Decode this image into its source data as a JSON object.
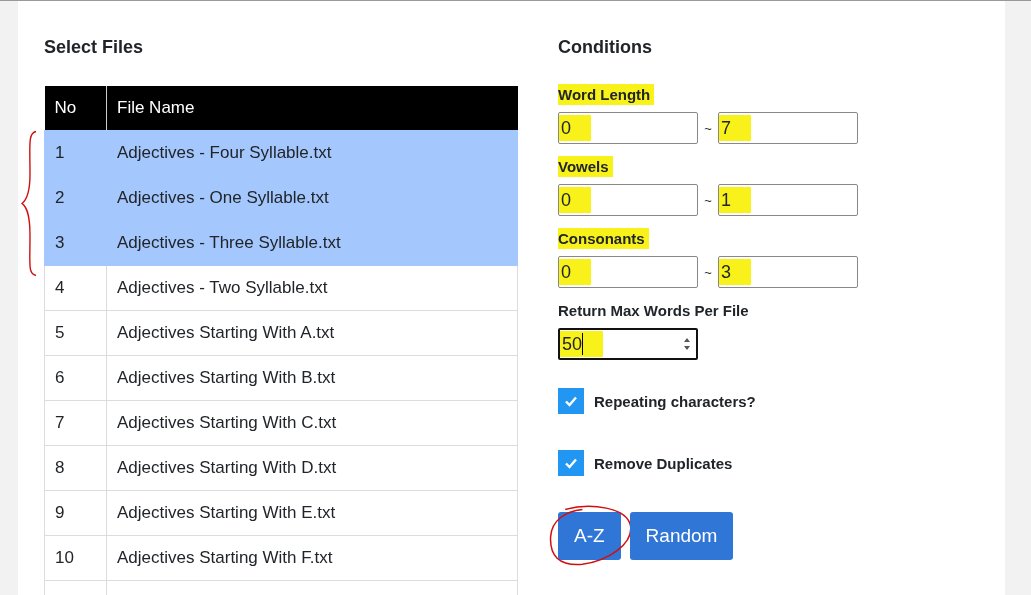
{
  "files": {
    "title": "Select Files",
    "columns": [
      "No",
      "File Name"
    ],
    "rows": [
      {
        "no": "1",
        "name": "Adjectives - Four Syllable.txt",
        "selected": true
      },
      {
        "no": "2",
        "name": "Adjectives - One Syllable.txt",
        "selected": true
      },
      {
        "no": "3",
        "name": "Adjectives - Three Syllable.txt",
        "selected": true
      },
      {
        "no": "4",
        "name": "Adjectives - Two Syllable.txt",
        "selected": false
      },
      {
        "no": "5",
        "name": "Adjectives Starting With A.txt",
        "selected": false
      },
      {
        "no": "6",
        "name": "Adjectives Starting With B.txt",
        "selected": false
      },
      {
        "no": "7",
        "name": "Adjectives Starting With C.txt",
        "selected": false
      },
      {
        "no": "8",
        "name": "Adjectives Starting With D.txt",
        "selected": false
      },
      {
        "no": "9",
        "name": "Adjectives Starting With E.txt",
        "selected": false
      },
      {
        "no": "10",
        "name": "Adjectives Starting With F.txt",
        "selected": false
      }
    ]
  },
  "conditions": {
    "title": "Conditions",
    "ranges": [
      {
        "label": "Word Length",
        "label_highlighted": true,
        "min": "0",
        "min_highlighted": true,
        "separator": "~",
        "max": "7",
        "max_highlighted": true
      },
      {
        "label": "Vowels",
        "label_highlighted": true,
        "min": "0",
        "min_highlighted": true,
        "separator": "~",
        "max": "1",
        "max_highlighted": true
      },
      {
        "label": "Consonants",
        "label_highlighted": true,
        "min": "0",
        "min_highlighted": true,
        "separator": "~",
        "max": "3",
        "max_highlighted": true
      }
    ],
    "max_words": {
      "label": "Return Max Words Per File",
      "value": "50",
      "highlighted": true,
      "focused": true
    },
    "options": [
      {
        "label": "Repeating characters?",
        "checked": true
      },
      {
        "label": "Remove Duplicates",
        "checked": true
      }
    ],
    "buttons": [
      {
        "label": "A-Z",
        "circled": true
      },
      {
        "label": "Random",
        "circled": false
      }
    ]
  }
}
